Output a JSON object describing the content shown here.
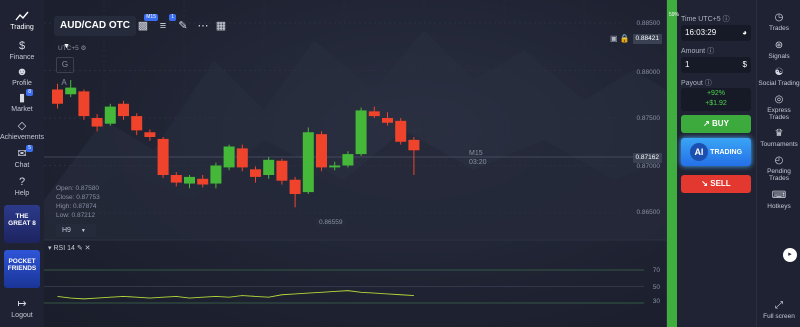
{
  "left_nav": {
    "items": [
      {
        "label": "Trading",
        "icon": "chart-icon"
      },
      {
        "label": "Finance",
        "icon": "dollar-icon"
      },
      {
        "label": "Profile",
        "icon": "user-icon"
      },
      {
        "label": "Market",
        "icon": "cart-icon"
      },
      {
        "label": "Achievements",
        "icon": "diamond-icon"
      },
      {
        "label": "Chat",
        "icon": "chat-icon"
      },
      {
        "label": "Help",
        "icon": "help-icon"
      }
    ],
    "badges": {
      "market": "8",
      "chat": "5"
    },
    "promo1": "THE GREAT 8",
    "promo2": "POCKET FRIENDS",
    "logout": "Logout"
  },
  "toolbar": {
    "pair": "AUD/CAD OTC",
    "timeframe_badge": "M15",
    "indicator_badge": "1"
  },
  "chart_header": {
    "timezone": "UTC+5",
    "g": "G",
    "a": "A"
  },
  "price_tags": {
    "top": "0.88421",
    "current": "0.87162"
  },
  "axis_prices": [
    "0.88500",
    "0.88000",
    "0.87500",
    "0.87000",
    "0.86500"
  ],
  "candle_label": {
    "tf": "M15",
    "timer": "03:20"
  },
  "low_label": "0.86559",
  "ohlc": {
    "open": "Open: 0.87580",
    "close": "Close: 0.87753",
    "high": "High: 0.87874",
    "low": "Low: 0.87212"
  },
  "h_select": "H9",
  "rsi": {
    "label": "RSI 14",
    "levels": [
      "70",
      "50",
      "30"
    ]
  },
  "panel": {
    "time_label": "Time UTC+5",
    "time_value": "16:03:29",
    "amount_label": "Amount",
    "amount_value": "1",
    "payout_label": "Payout",
    "payout_pct": "+92%",
    "payout_value": "+$1.92",
    "buy": "BUY",
    "ai": "AI",
    "trading": "TRADING",
    "sell": "SELL",
    "side_pct": "59%"
  },
  "right_nav": {
    "items": [
      {
        "label": "Trades",
        "icon": "clock-icon"
      },
      {
        "label": "Signals",
        "icon": "signal-icon"
      },
      {
        "label": "Social Trading",
        "icon": "people-icon"
      },
      {
        "label": "Express Trades",
        "icon": "express-icon"
      },
      {
        "label": "Tournaments",
        "icon": "trophy-icon"
      },
      {
        "label": "Pending Trades",
        "icon": "pending-icon"
      },
      {
        "label": "Hotkeys",
        "icon": "keyboard-icon"
      }
    ],
    "fullscreen": "Full screen"
  },
  "chart_data": {
    "type": "candlestick",
    "timeframe": "M15",
    "y_ticks": [
      0.885,
      0.88,
      0.875,
      0.87,
      0.865
    ],
    "candles": [
      {
        "o": 0.878,
        "c": 0.8765,
        "h": 0.8786,
        "l": 0.876
      },
      {
        "o": 0.8775,
        "c": 0.8782,
        "h": 0.879,
        "l": 0.8772
      },
      {
        "o": 0.8778,
        "c": 0.8752,
        "h": 0.878,
        "l": 0.8748
      },
      {
        "o": 0.875,
        "c": 0.8741,
        "h": 0.8754,
        "l": 0.8736
      },
      {
        "o": 0.8744,
        "c": 0.8762,
        "h": 0.8765,
        "l": 0.8742
      },
      {
        "o": 0.8765,
        "c": 0.8752,
        "h": 0.8768,
        "l": 0.8748
      },
      {
        "o": 0.8752,
        "c": 0.8737,
        "h": 0.8755,
        "l": 0.8732
      },
      {
        "o": 0.8735,
        "c": 0.873,
        "h": 0.8738,
        "l": 0.8726
      },
      {
        "o": 0.8728,
        "c": 0.869,
        "h": 0.873,
        "l": 0.8687
      },
      {
        "o": 0.869,
        "c": 0.8682,
        "h": 0.8693,
        "l": 0.8678
      },
      {
        "o": 0.8681,
        "c": 0.8688,
        "h": 0.869,
        "l": 0.8676
      },
      {
        "o": 0.8686,
        "c": 0.868,
        "h": 0.869,
        "l": 0.8677
      },
      {
        "o": 0.8681,
        "c": 0.87,
        "h": 0.8703,
        "l": 0.8676
      },
      {
        "o": 0.8698,
        "c": 0.872,
        "h": 0.8722,
        "l": 0.8695
      },
      {
        "o": 0.8718,
        "c": 0.8698,
        "h": 0.8722,
        "l": 0.8694
      },
      {
        "o": 0.8696,
        "c": 0.8688,
        "h": 0.8699,
        "l": 0.8682
      },
      {
        "o": 0.869,
        "c": 0.8706,
        "h": 0.8709,
        "l": 0.8686
      },
      {
        "o": 0.8705,
        "c": 0.8684,
        "h": 0.8707,
        "l": 0.868
      },
      {
        "o": 0.8685,
        "c": 0.867,
        "h": 0.8688,
        "l": 0.8656
      },
      {
        "o": 0.8672,
        "c": 0.8735,
        "h": 0.874,
        "l": 0.867
      },
      {
        "o": 0.8733,
        "c": 0.8698,
        "h": 0.8736,
        "l": 0.8694
      },
      {
        "o": 0.8698,
        "c": 0.87,
        "h": 0.8704,
        "l": 0.8695
      },
      {
        "o": 0.87,
        "c": 0.8712,
        "h": 0.8715,
        "l": 0.8698
      },
      {
        "o": 0.8712,
        "c": 0.8758,
        "h": 0.8761,
        "l": 0.871
      },
      {
        "o": 0.8757,
        "c": 0.8752,
        "h": 0.8762,
        "l": 0.875
      },
      {
        "o": 0.875,
        "c": 0.8745,
        "h": 0.8756,
        "l": 0.8742
      },
      {
        "o": 0.8747,
        "c": 0.8725,
        "h": 0.875,
        "l": 0.8722
      },
      {
        "o": 0.8727,
        "c": 0.8716,
        "h": 0.873,
        "l": 0.869
      }
    ],
    "rsi_levels": [
      70,
      50,
      30
    ]
  }
}
